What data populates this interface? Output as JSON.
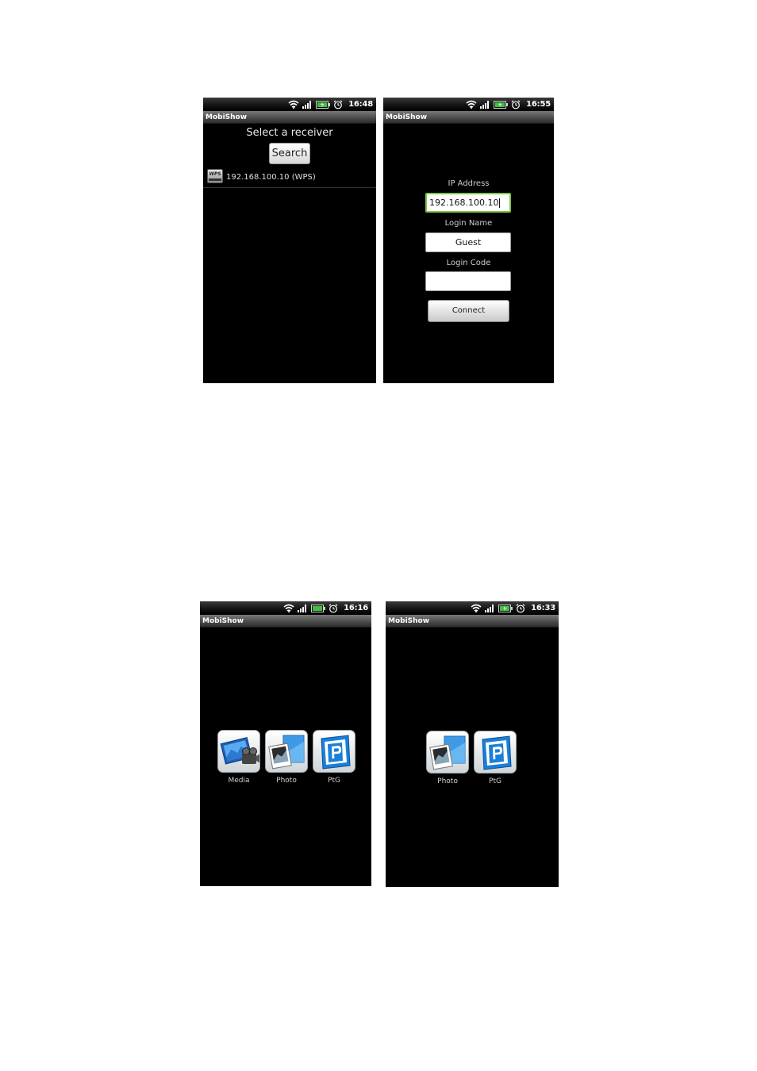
{
  "screens": [
    {
      "app_title": "MobiShow",
      "status_time": "16:48",
      "heading": "Select a receiver",
      "search_label": "Search",
      "receiver_icon_label": "WPS",
      "receiver_text": "192.168.100.10 (WPS)"
    },
    {
      "app_title": "MobiShow",
      "status_time": "16:55",
      "ip_label": "IP Address",
      "ip_value": "192.168.100.10",
      "login_name_label": "Login Name",
      "login_name_value": "Guest",
      "login_code_label": "Login Code",
      "login_code_value": "",
      "connect_label": "Connect"
    },
    {
      "app_title": "MobiShow",
      "status_time": "16:16",
      "apps": [
        "Media",
        "Photo",
        "PtG"
      ]
    },
    {
      "app_title": "MobiShow",
      "status_time": "16:33",
      "apps": [
        "Photo",
        "PtG"
      ]
    }
  ],
  "icons": {
    "status": [
      "wifi-icon",
      "signal-icon",
      "battery-icon",
      "alarm-icon"
    ],
    "apps": {
      "Media": "media-app-icon",
      "Photo": "photo-app-icon",
      "PtG": "ptg-app-icon"
    }
  },
  "colors": {
    "screen_bg": "#000000",
    "focus_border": "#7cc545",
    "battery_green": "#3fbf3f",
    "ptg_blue": "#1a7fd8"
  }
}
